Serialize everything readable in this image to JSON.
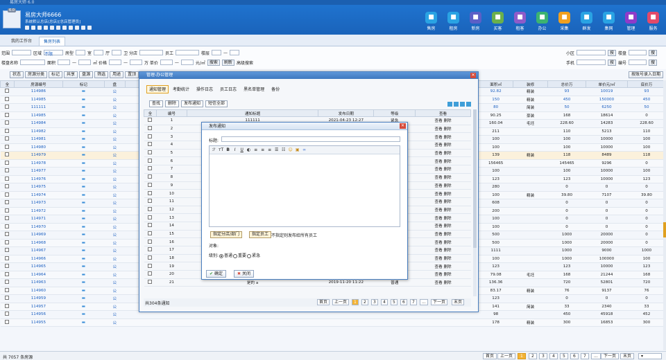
{
  "window": {
    "title": "易房大师 6.0"
  },
  "header": {
    "brand": "易房大师6666",
    "subtitle": "系统默认总店(总店)[总店管理员]",
    "logo_badge": "6.0",
    "nav": [
      {
        "label": "售房",
        "icon": "house-icon",
        "color": "#2aa3e3"
      },
      {
        "label": "租房",
        "icon": "key-icon",
        "color": "#2aa3e3"
      },
      {
        "label": "新房",
        "icon": "building-icon",
        "color": "#5b5fc7"
      },
      {
        "label": "买客",
        "icon": "buyer-icon",
        "color": "#6ab04c"
      },
      {
        "label": "租客",
        "icon": "renter-icon",
        "color": "#8e5bc9"
      },
      {
        "label": "办公",
        "icon": "office-icon",
        "color": "#3cb371"
      },
      {
        "label": "采集",
        "icon": "cloud-icon",
        "color": "#f0a020"
      },
      {
        "label": "群发",
        "icon": "send-icon",
        "color": "#2aa3e3"
      },
      {
        "label": "集网",
        "icon": "globe-icon",
        "color": "#2aa3e3"
      },
      {
        "label": "管理",
        "icon": "gear-icon",
        "color": "#8e3bc9"
      },
      {
        "label": "服务",
        "icon": "service-icon",
        "color": "#e24a6a"
      }
    ]
  },
  "tabs": [
    {
      "label": "我的工作台"
    },
    {
      "label": "售房列表",
      "active": true
    }
  ],
  "filters": {
    "row1": [
      "范围",
      "区域",
      "不限",
      "房型",
      "室",
      "厅",
      "卫 分店",
      "员工",
      "楼层",
      "—",
      "小区",
      "按",
      "楼盘",
      "搜"
    ],
    "row2": [
      "楼盘名称",
      "面积",
      "—",
      "㎡ 价格",
      "—",
      "万 单价",
      "—",
      "元/㎡",
      "搜索",
      "刷新",
      "高级搜索",
      "手机",
      "按",
      "编号",
      "搜"
    ]
  },
  "toolbar": [
    "状态",
    "房源分类",
    "标记",
    "共享",
    "盘源",
    "筛选",
    "用途",
    "置顶",
    "按账号录入日期"
  ],
  "main": {
    "headers": [
      "全",
      "房源编号",
      "标记",
      "盘",
      "面积㎡",
      "装修",
      "总价万",
      "单价元/㎡",
      "底价万"
    ],
    "rows": [
      [
        "114986",
        "公",
        "92.82",
        "精装",
        "93",
        "10019",
        "93"
      ],
      [
        "114985",
        "公",
        "150",
        "精装",
        "450",
        "150000",
        "450"
      ],
      [
        "111111",
        "公",
        "80",
        "简装",
        "50",
        "6250",
        "50"
      ],
      [
        "114985",
        "公",
        "90.25",
        "豪装",
        "168",
        "18614",
        "0"
      ],
      [
        "114984",
        "公",
        "160.04",
        "毛坯",
        "228.60",
        "14283",
        "228.60"
      ],
      [
        "114982",
        "公",
        "211",
        "",
        "110",
        "5213",
        "110"
      ],
      [
        "114981",
        "公",
        "100",
        "",
        "100",
        "10000",
        "100"
      ],
      [
        "114980",
        "公",
        "100",
        "",
        "100",
        "10000",
        "100"
      ],
      [
        "114979",
        "公",
        "139",
        "精装",
        "118",
        "8489",
        "118"
      ],
      [
        "114978",
        "公",
        "156465",
        "",
        "145465",
        "9296",
        "0"
      ],
      [
        "114977",
        "公",
        "100",
        "",
        "100",
        "10000",
        "100"
      ],
      [
        "114976",
        "公",
        "123",
        "",
        "123",
        "10000",
        "123"
      ],
      [
        "114975",
        "公",
        "280",
        "",
        "0",
        "0",
        "0"
      ],
      [
        "114974",
        "公",
        "100",
        "精装",
        "39.80",
        "7107",
        "39.80"
      ],
      [
        "114973",
        "公",
        "608",
        "",
        "0",
        "0",
        "0"
      ],
      [
        "114972",
        "公",
        "200",
        "",
        "0",
        "0",
        "0"
      ],
      [
        "114971",
        "公",
        "100",
        "",
        "0",
        "0",
        "0"
      ],
      [
        "114970",
        "公",
        "100",
        "",
        "0",
        "0",
        "0"
      ],
      [
        "114969",
        "公",
        "500",
        "",
        "1000",
        "20000",
        "0"
      ],
      [
        "114968",
        "公",
        "500",
        "",
        "1000",
        "20000",
        "0"
      ],
      [
        "114967",
        "公",
        "1111",
        "",
        "1000",
        "9000",
        "1000"
      ],
      [
        "114966",
        "公",
        "100",
        "",
        "1000",
        "100000",
        "100"
      ],
      [
        "114965",
        "公",
        "123",
        "",
        "123",
        "10000",
        "123"
      ],
      [
        "114964",
        "公",
        "79.08",
        "毛坯",
        "168",
        "21244",
        "168"
      ],
      [
        "114963",
        "公",
        "136.36",
        "",
        "720",
        "52801",
        "720"
      ],
      [
        "114960",
        "公",
        "83.17",
        "精装",
        "76",
        "9137",
        "76"
      ],
      [
        "114959",
        "公",
        "123",
        "",
        "0",
        "0",
        "0"
      ],
      [
        "114957",
        "公",
        "141",
        "简装",
        "33",
        "2340",
        "33"
      ],
      [
        "114956",
        "公",
        "98",
        "",
        "450",
        "45918",
        "452"
      ],
      [
        "114955",
        "公",
        "178",
        "精装",
        "300",
        "16853",
        "300"
      ]
    ]
  },
  "bottom": {
    "count": "共 7057 条房源",
    "first": "首页",
    "prev": "上一页",
    "pages": [
      "1",
      "2",
      "3",
      "4",
      "5",
      "6",
      "7",
      "..."
    ],
    "next": "下一页",
    "last": "末页"
  },
  "office": {
    "title": "管理-办公管理",
    "tabs": [
      "通知管理",
      "考勤统计",
      "操作日志",
      "员工日志",
      "黑名单管理",
      "备份"
    ],
    "buttons": [
      "查找",
      "删除",
      "发布通知",
      "短信全部"
    ],
    "headers": [
      "全",
      "编号",
      "通知标题",
      "发布日期",
      "等级",
      "查看"
    ],
    "rows": [
      [
        "1",
        "111111",
        "2021-04-23 12:27",
        "紧急",
        "查看 删除"
      ],
      [
        "2",
        "",
        "",
        "",
        "查看 删除"
      ],
      [
        "3",
        "",
        "",
        "",
        "查看 删除"
      ],
      [
        "4",
        "",
        "",
        "",
        "查看 删除"
      ],
      [
        "5",
        "",
        "",
        "",
        "查看 删除"
      ],
      [
        "6",
        "",
        "",
        "",
        "查看 删除"
      ],
      [
        "7",
        "",
        "",
        "",
        "查看 删除"
      ],
      [
        "8",
        "",
        "",
        "",
        "查看 删除"
      ],
      [
        "9",
        "",
        "",
        "",
        "查看 删除"
      ],
      [
        "10",
        "",
        "",
        "",
        "查看 删除"
      ],
      [
        "11",
        "",
        "",
        "",
        "查看 删除"
      ],
      [
        "12",
        "",
        "",
        "",
        "查看 删除"
      ],
      [
        "13",
        "",
        "",
        "",
        "查看 删除"
      ],
      [
        "14",
        "",
        "",
        "",
        "查看 删除"
      ],
      [
        "15",
        "",
        "",
        "",
        "查看 删除"
      ],
      [
        "16",
        "",
        "",
        "",
        "查看 删除"
      ],
      [
        "17",
        "",
        "",
        "",
        "查看 删除"
      ],
      [
        "18",
        "",
        "",
        "",
        "查看 删除"
      ],
      [
        "19",
        "",
        "",
        "",
        "查看 删除"
      ],
      [
        "20",
        "11111",
        "2019-11-20 11:26",
        "普通",
        "查看 删除"
      ],
      [
        "21",
        "是的 a",
        "2019-11-20 11:22",
        "普通",
        "查看 删除"
      ]
    ],
    "footer": {
      "count": "共304条通知",
      "first": "首页",
      "prev": "上一页",
      "pages": [
        "1",
        "2",
        "3",
        "4",
        "5",
        "6",
        "7",
        "..."
      ],
      "next": "下一页",
      "last": "末页"
    }
  },
  "notice": {
    "title": "发布通知",
    "title_label": "标题:",
    "assign_dept": "指定分店/部门",
    "assign_staff": "指定员工",
    "assign_hint": "不指定则发布给所有员工",
    "target_label": "对象:",
    "level_label": "级别:",
    "levels": [
      "普通",
      "重要",
      "紧急"
    ],
    "ok": "确定",
    "close": "关闭"
  }
}
